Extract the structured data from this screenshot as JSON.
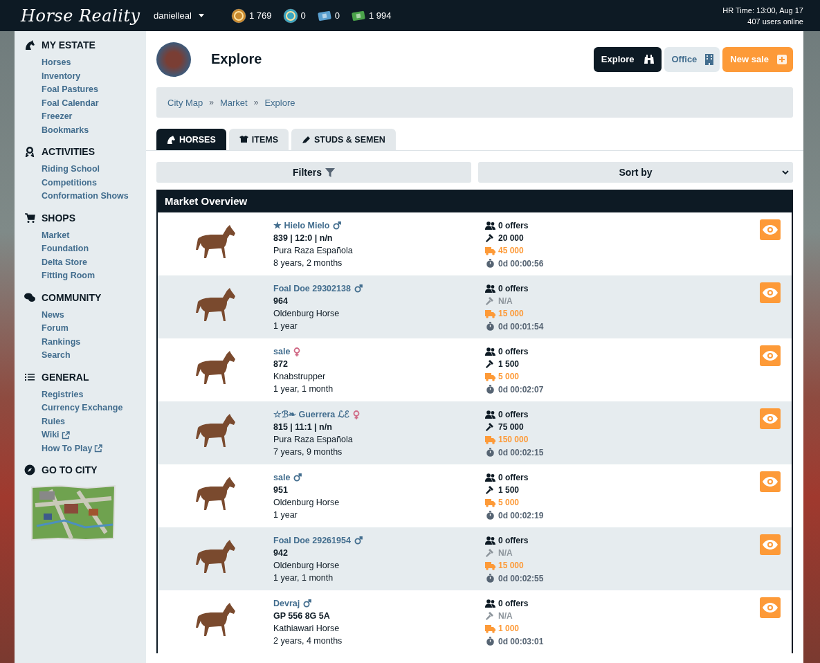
{
  "topbar": {
    "logo": "Horse Reality",
    "username": "danielleal",
    "currencies": [
      {
        "kind": "coins",
        "amount": "1 769"
      },
      {
        "kind": "dp",
        "amount": "0"
      },
      {
        "kind": "f",
        "amount": "0"
      },
      {
        "kind": "w",
        "amount": "1 994"
      }
    ],
    "time": "HR Time: 13:00, Aug 17",
    "online": "407 users online"
  },
  "sidebar": {
    "sections": [
      {
        "title": "MY ESTATE",
        "links": [
          {
            "label": "Horses",
            "external": false
          },
          {
            "label": "Inventory",
            "external": false
          },
          {
            "label": "Foal Pastures",
            "external": false
          },
          {
            "label": "Foal Calendar",
            "external": false
          },
          {
            "label": "Freezer",
            "external": false
          },
          {
            "label": "Bookmarks",
            "external": false
          }
        ]
      },
      {
        "title": "ACTIVITIES",
        "links": [
          {
            "label": "Riding School",
            "external": false
          },
          {
            "label": "Competitions",
            "external": false
          },
          {
            "label": "Conformation Shows",
            "external": false
          }
        ]
      },
      {
        "title": "SHOPS",
        "links": [
          {
            "label": "Market",
            "external": false
          },
          {
            "label": "Foundation",
            "external": false
          },
          {
            "label": "Delta Store",
            "external": false
          },
          {
            "label": "Fitting Room",
            "external": false
          }
        ]
      },
      {
        "title": "COMMUNITY",
        "links": [
          {
            "label": "News",
            "external": false
          },
          {
            "label": "Forum",
            "external": false
          },
          {
            "label": "Rankings",
            "external": false
          },
          {
            "label": "Search",
            "external": false
          }
        ]
      },
      {
        "title": "GENERAL",
        "links": [
          {
            "label": "Registries",
            "external": false
          },
          {
            "label": "Currency Exchange",
            "external": false
          },
          {
            "label": "Rules",
            "external": false
          },
          {
            "label": "Wiki",
            "external": true
          },
          {
            "label": "How To Play",
            "external": true
          }
        ]
      },
      {
        "title": "GO TO CITY"
      }
    ]
  },
  "page": {
    "title": "Explore",
    "actions": [
      {
        "kind": "explore",
        "label": "Explore"
      },
      {
        "kind": "office",
        "label": "Office"
      },
      {
        "kind": "new",
        "label": "New sale"
      }
    ],
    "breadcrumb": [
      "City Map",
      "Market",
      "Explore"
    ],
    "breadcrumb_separator": "»",
    "tabs": [
      {
        "label": "HORSES",
        "selected": true
      },
      {
        "label": "ITEMS",
        "selected": false
      },
      {
        "label": "STUDS & SEMEN",
        "selected": false
      }
    ],
    "filters": "Filters",
    "sort": "Sort by"
  },
  "market": {
    "title": "Market Overview",
    "rows": [
      {
        "name": "★ Hielo Mielo",
        "male": true,
        "stats": "839 | 12:0 | n/n",
        "breed": "Pura Raza Española",
        "age": "8 years, 2 months",
        "offers": "0 offers",
        "bid": {
          "value": "20 000",
          "disabled": false
        },
        "price": "45 000",
        "time": "0d 00:00:56"
      },
      {
        "name": "Foal Doe 29302138",
        "male": true,
        "stats": "964",
        "breed": "Oldenburg Horse",
        "age": "1 year",
        "offers": "0 offers",
        "bid": {
          "value": "N/A",
          "disabled": true
        },
        "price": "15 000",
        "time": "0d 00:01:54"
      },
      {
        "name": "sale",
        "male": false,
        "stats": "872",
        "breed": "Knabstrupper",
        "age": "1 year, 1 month",
        "offers": "0 offers",
        "bid": {
          "value": "1 500",
          "disabled": false
        },
        "price": "5 000",
        "time": "0d 00:02:07"
      },
      {
        "name": "☆ℬ❧ Guerrera ℒℰ",
        "male": false,
        "stats": "815 | 11:1 | n/n",
        "breed": "Pura Raza Española",
        "age": "7 years, 9 months",
        "offers": "0 offers",
        "bid": {
          "value": "75 000",
          "disabled": false
        },
        "price": "150 000",
        "time": "0d 00:02:15"
      },
      {
        "name": "sale",
        "male": true,
        "stats": "951",
        "breed": "Oldenburg Horse",
        "age": "1 year",
        "offers": "0 offers",
        "bid": {
          "value": "1 500",
          "disabled": false
        },
        "price": "5 000",
        "time": "0d 00:02:19"
      },
      {
        "name": "Foal Doe 29261954",
        "male": true,
        "stats": "942",
        "breed": "Oldenburg Horse",
        "age": "1 year, 1 month",
        "offers": "0 offers",
        "bid": {
          "value": "N/A",
          "disabled": true
        },
        "price": "15 000",
        "time": "0d 00:02:55"
      },
      {
        "name": "Devraj",
        "male": true,
        "stats": "GP 556 8G 5A",
        "breed": "Kathiawari Horse",
        "age": "2 years, 4 months",
        "offers": "0 offers",
        "bid": {
          "value": "N/A",
          "disabled": true
        },
        "price": "1 000",
        "time": "0d 00:03:01"
      }
    ]
  }
}
